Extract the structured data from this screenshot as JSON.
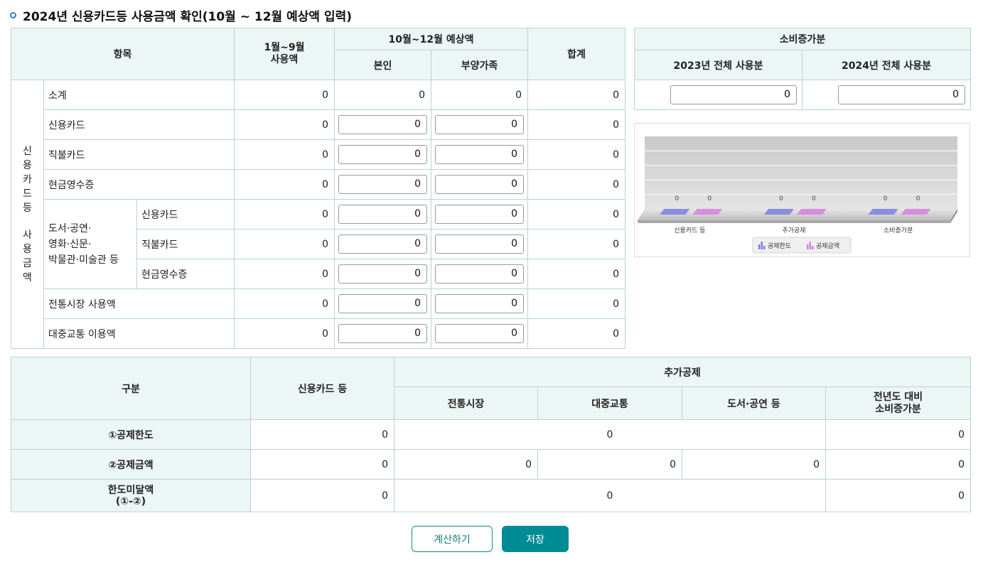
{
  "title": "2024년 신용카드등 사용금액 확인(10월 ~ 12월 예상액 입력)",
  "main_table": {
    "headers": {
      "item": "항목",
      "jan_sep": "1월~9월\n사용액",
      "forecast": "10월~12월 예상액",
      "self": "본인",
      "dependents": "부양가족",
      "total": "합계"
    },
    "vertical_label_1": [
      "신",
      "용",
      "카",
      "드",
      "등"
    ],
    "vertical_label_2": [
      "사",
      "용",
      "금",
      "액"
    ],
    "group_label": "도서·공연·\n영화·신문·\n박물관·미술관 등",
    "rows": [
      {
        "label": "소계",
        "jan_sep": "0",
        "self": "0",
        "dependents": "0",
        "total": "0"
      },
      {
        "label": "신용카드",
        "jan_sep": "0",
        "self": "0",
        "dependents": "0",
        "total": "0"
      },
      {
        "label": "직불카드",
        "jan_sep": "0",
        "self": "0",
        "dependents": "0",
        "total": "0"
      },
      {
        "label": "현금영수증",
        "jan_sep": "0",
        "self": "0",
        "dependents": "0",
        "total": "0"
      },
      {
        "label": "신용카드",
        "jan_sep": "0",
        "self": "0",
        "dependents": "0",
        "total": "0"
      },
      {
        "label": "직불카드",
        "jan_sep": "0",
        "self": "0",
        "dependents": "0",
        "total": "0"
      },
      {
        "label": "현금영수증",
        "jan_sep": "0",
        "self": "0",
        "dependents": "0",
        "total": "0"
      },
      {
        "label": "전통시장 사용액",
        "jan_sep": "0",
        "self": "0",
        "dependents": "0",
        "total": "0"
      },
      {
        "label": "대중교통 이용액",
        "jan_sep": "0",
        "self": "0",
        "dependents": "0",
        "total": "0"
      }
    ]
  },
  "side_table": {
    "header": "소비증가분",
    "col_2023": "2023년 전체 사용분",
    "col_2024": "2024년 전체 사용분",
    "val_2023": "0",
    "val_2024": "0"
  },
  "chart_data": {
    "type": "bar",
    "categories": [
      "신용카드 등",
      "추가공제",
      "소비증가분"
    ],
    "series": [
      {
        "name": "공제한도",
        "values": [
          0,
          0,
          0
        ],
        "color": "#7b7fe0"
      },
      {
        "name": "공제금액",
        "values": [
          0,
          0,
          0
        ],
        "color": "#d77fe0"
      }
    ],
    "data_labels": [
      "0",
      "0",
      "0",
      "0",
      "0",
      "0"
    ],
    "legend_position": "bottom",
    "grid": true
  },
  "bottom_table": {
    "headers": {
      "category": "구분",
      "credit": "신용카드 등",
      "extra": "추가공제",
      "market": "전통시장",
      "transit": "대중교통",
      "books": "도서·공연 등",
      "increase": "전년도 대비\n소비증가분"
    },
    "rows": {
      "limit": {
        "label": "①공제한도",
        "credit": "0",
        "extra": "0",
        "increase": "0"
      },
      "amount": {
        "label": "②공제금액",
        "credit": "0",
        "market": "0",
        "transit": "0",
        "books": "0",
        "increase": "0"
      },
      "shortfall": {
        "label": "한도미달액\n(①-②)",
        "credit": "0",
        "extra": "0",
        "increase": "0"
      }
    }
  },
  "buttons": {
    "calculate": "계산하기",
    "save": "저장"
  }
}
